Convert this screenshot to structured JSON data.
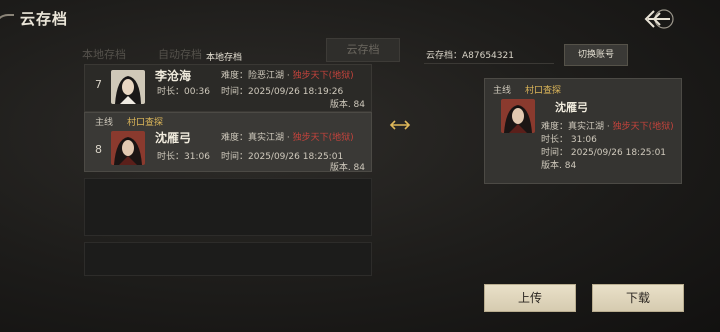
{
  "header": {
    "title": "云存档"
  },
  "tabs": {
    "local": "本地存档",
    "auto": "自动存档",
    "local_active": "本地存档",
    "cloud": "云存档"
  },
  "cloud": {
    "label": "云存档：A87654321",
    "switch_label": "切换账号"
  },
  "local_saves": [
    {
      "slot": "7",
      "name": "李沧海",
      "difficulty_label": "难度：",
      "difficulty": "险恶江湖",
      "sep": "·",
      "mode": "独步天下(地狱)",
      "duration_label": "时长：",
      "duration": "00:36",
      "time_label": "时间：",
      "time": "2025/09/26 18:19:26",
      "version": "版本. 84"
    },
    {
      "slot": "8",
      "name": "沈雁弓",
      "quest_type": "主线",
      "quest": "村口查探",
      "difficulty_label": "难度：",
      "difficulty": "真实江湖",
      "sep": "·",
      "mode": "独步天下(地狱)",
      "duration_label": "时长：",
      "duration": "31:06",
      "time_label": "时间：",
      "time": "2025/09/26 18:25:01",
      "version": "版本. 84"
    }
  ],
  "cloud_save": {
    "quest_type": "主线",
    "quest": "村口查探",
    "name": "沈雁弓",
    "difficulty_label": "难度：真实江湖 ·",
    "mode": "独步天下(地狱)",
    "duration": "时长： 31:06",
    "time": "时间： 2025/09/26 18:25:01",
    "version": "版本. 84"
  },
  "buttons": {
    "upload": "上传",
    "download": "下载"
  },
  "icons": {
    "back": "back-arrow-icon",
    "sync": "double-arrow-icon"
  }
}
